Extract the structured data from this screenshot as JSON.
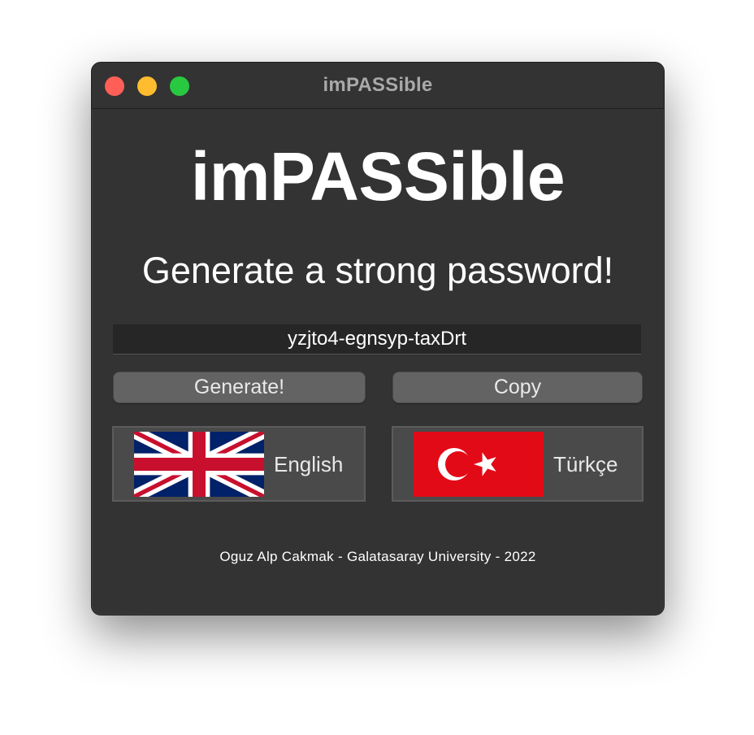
{
  "window": {
    "title": "imPASSible",
    "traffic_lights": {
      "close_color": "#ff5f57",
      "minimize_color": "#febc2e",
      "maximize_color": "#28c840"
    }
  },
  "main": {
    "app_title": "imPASSible",
    "subtitle": "Generate a strong password!",
    "password_value": "yzjto4-egnsyp-taxDrt",
    "buttons": {
      "generate_label": "Generate!",
      "copy_label": "Copy"
    },
    "languages": [
      {
        "label": "English",
        "flag_icon": "uk-flag-icon"
      },
      {
        "label": "Türkçe",
        "flag_icon": "turkey-flag-icon"
      }
    ],
    "footer": "Oguz Alp Cakmak - Galatasaray University - 2022"
  },
  "colors": {
    "window_bg": "#333333",
    "field_bg": "#262626",
    "button_bg": "#636363",
    "lang_bg": "#4a4a4a"
  }
}
